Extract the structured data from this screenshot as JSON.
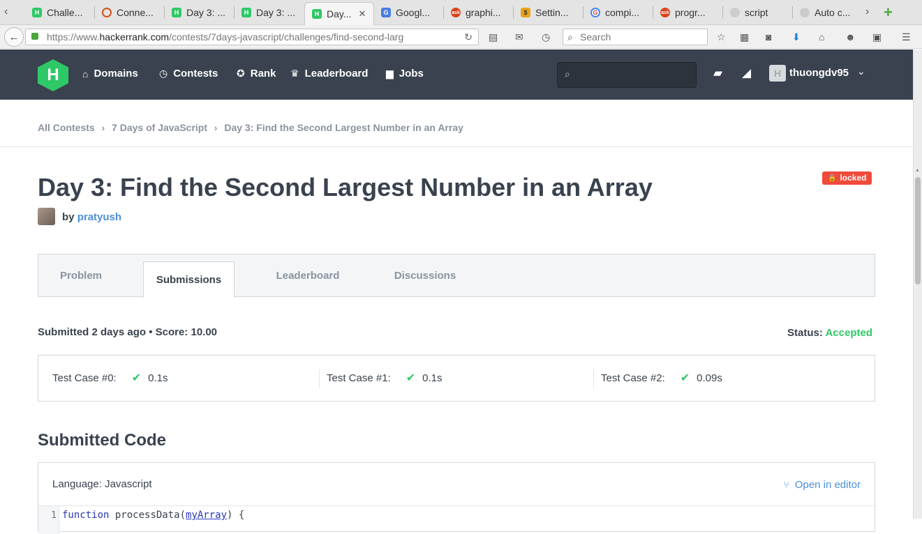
{
  "browser": {
    "tabs": [
      {
        "label": "Challe...",
        "icon": "hackerrank-icon"
      },
      {
        "label": "Conne...",
        "icon": "opera-ring-icon"
      },
      {
        "label": "Day 3: ...",
        "icon": "hackerrank-icon"
      },
      {
        "label": "Day 3: ...",
        "icon": "hackerrank-icon"
      },
      {
        "label": "Day...",
        "icon": "hackerrank-icon",
        "active": true
      },
      {
        "label": "Googl...",
        "icon": "google-translate-icon"
      },
      {
        "label": "graphi...",
        "icon": "ask-icon"
      },
      {
        "label": "Settin...",
        "icon": "bitcoin-icon"
      },
      {
        "label": "compi...",
        "icon": "google-icon"
      },
      {
        "label": "progr...",
        "icon": "ask-icon"
      },
      {
        "label": "script",
        "icon": "globe-icon"
      },
      {
        "label": "Auto c...",
        "icon": "globe-icon"
      }
    ],
    "url_prefix": "https://www.",
    "url_host": "hackerrank.com",
    "url_path": "/contests/7days-javascript/challenges/find-second-larg",
    "search_placeholder": "Search"
  },
  "site": {
    "brand_color": "#2ec866",
    "header_color": "#39424e",
    "logo_letter": "H",
    "nav": [
      {
        "label": "Domains",
        "icon": "home-icon"
      },
      {
        "label": "Contests",
        "icon": "clock-icon"
      },
      {
        "label": "Rank",
        "icon": "medal-icon"
      },
      {
        "label": "Leaderboard",
        "icon": "trophy-icon"
      },
      {
        "label": "Jobs",
        "icon": "briefcase-icon"
      }
    ],
    "username": "thuongdv95",
    "avatar_letter": "H"
  },
  "breadcrumb": [
    "All Contests",
    "7 Days of JavaScript",
    "Day 3: Find the Second Largest Number in an Array"
  ],
  "challenge": {
    "title": "Day 3: Find the Second Largest Number in an Array",
    "locked_label": "locked",
    "by_label": "by",
    "author": "pratyush"
  },
  "tabs": [
    "Problem",
    "Submissions",
    "Leaderboard",
    "Discussions"
  ],
  "active_tab": "Submissions",
  "submission": {
    "summary": "Submitted 2 days ago • Score: 10.00",
    "status_label": "Status:",
    "status_value": "Accepted",
    "test_cases": [
      {
        "label": "Test Case #0:",
        "time": "0.1s"
      },
      {
        "label": "Test Case #1:",
        "time": "0.1s"
      },
      {
        "label": "Test Case #2:",
        "time": "0.09s"
      }
    ]
  },
  "code": {
    "heading": "Submitted Code",
    "language": "Language: Javascript",
    "open_editor": "Open in editor",
    "line_number": "1",
    "line_keyword": "function",
    "line_name": " processData(",
    "line_arg": "myArray",
    "line_rest": ") {"
  }
}
